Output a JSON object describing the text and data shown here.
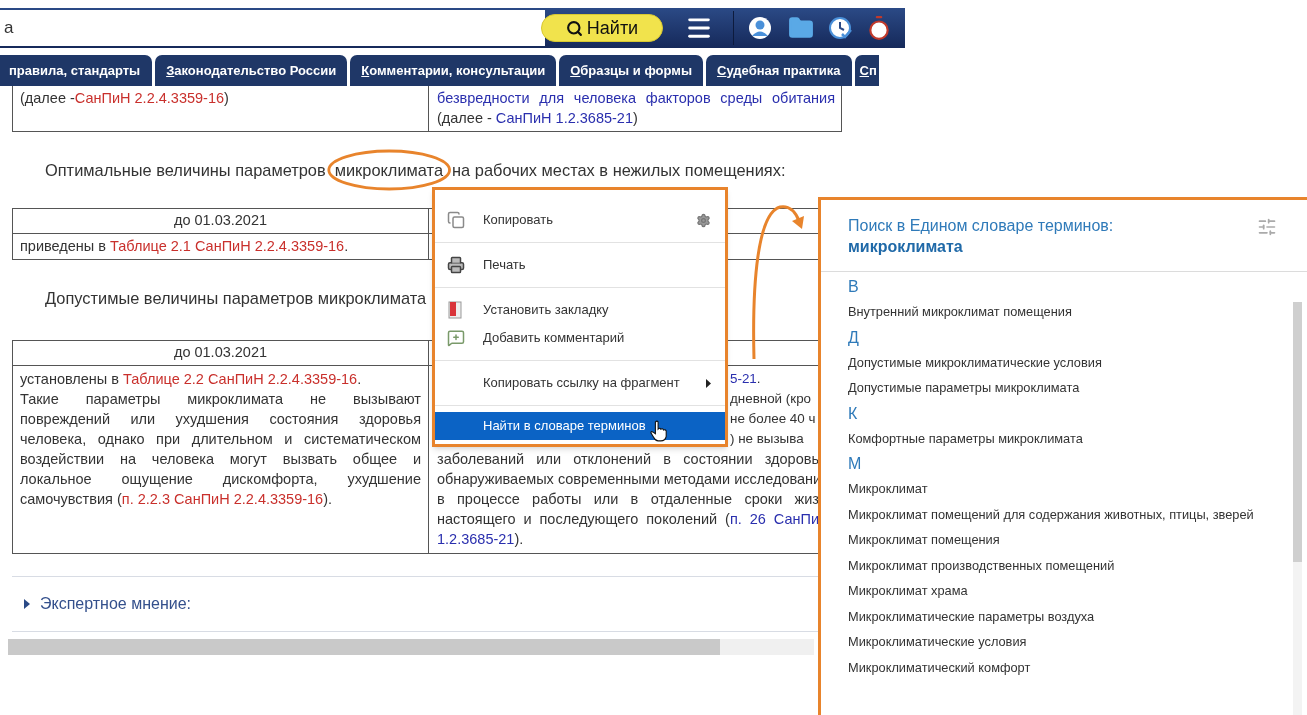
{
  "search": {
    "value": "а",
    "button": "Найти"
  },
  "tabs": [
    {
      "label": "правила, стандарты",
      "underline_first": false,
      "selected": false
    },
    {
      "label": "Законодательство России",
      "underline_first": true,
      "selected": false
    },
    {
      "label": "Комментарии, консультации",
      "underline_first": true,
      "selected": false
    },
    {
      "label": "Образцы и формы",
      "underline_first": true,
      "selected": false
    },
    {
      "label": "Судебная практика",
      "underline_first": true,
      "selected": false
    },
    {
      "label": "Сп",
      "underline_first": true,
      "selected": false
    }
  ],
  "document": {
    "top_table": {
      "left": [
        [
          {
            "text": "(далее -"
          },
          {
            "text": "СанПиН 2.2.4.3359-16",
            "link": true
          },
          {
            "text": ")"
          }
        ]
      ],
      "right": [
        {
          "kind": "full",
          "segments": [
            {
              "text": "безвредности для человека факторов среды обитания",
              "link": true
            }
          ]
        },
        {
          "kind": "last",
          "segments": [
            {
              "text": "(далее - "
            },
            {
              "text": "СанПиН 1.2.3685-21",
              "link": true
            },
            {
              "text": ")"
            }
          ]
        }
      ]
    },
    "paragraph_1": {
      "before": "Оптимальные величины параметров",
      "highlighted": "микроклимата",
      "after": "на рабочих местах в нежилых помещениях:"
    },
    "table_1": {
      "header": "до 01.03.2021",
      "cell": [
        {
          "text": "приведены в "
        },
        {
          "text": "Таблице 2.1 СанПиН 2.2.4.3359-16",
          "link": true
        },
        {
          "text": "."
        }
      ]
    },
    "paragraph_2": "Допустимые величины параметров микроклимата",
    "table_2": {
      "header": "до 01.03.2021",
      "left": [
        [
          {
            "text": "установлены в "
          },
          {
            "text": "Таблице 2.2 СанПиН 2.2.4.3359-16",
            "link": true
          },
          {
            "text": "."
          }
        ],
        [
          {
            "text": "Такие параметры микроклимата не вызывают повреждений или ухудшения состояния здоровья человека, однако при длительном и систематическом воздействии на человека могут вызвать общее и локальное ощущение дискомфорта, ухудшение самочувствия ("
          },
          {
            "text": "п. 2.2.3 СанПиН 2.2.4.3359-16",
            "link": true
          },
          {
            "text": ")."
          }
        ]
      ],
      "right": [
        {
          "kind": "partial",
          "segments": [
            {
              "text": "5-21",
              "link": true
            },
            {
              "text": "."
            }
          ]
        },
        {
          "kind": "partial",
          "segments": [
            {
              "text": "дневной (кро"
            }
          ]
        },
        {
          "kind": "partial",
          "segments": [
            {
              "text": "не более 40 ч"
            }
          ]
        },
        {
          "kind": "partial",
          "segments": [
            {
              "text": ") не вызыва"
            }
          ]
        },
        {
          "kind": "full",
          "segments": [
            {
              "text": "заболеваний или отклонений в состоянии здоровь"
            }
          ]
        },
        {
          "kind": "full",
          "segments": [
            {
              "text": "обнаруживаемых современными методами исследовани"
            }
          ]
        },
        {
          "kind": "full",
          "segments": [
            {
              "text": "в процессе работы или в отдаленные сроки жиз"
            }
          ]
        },
        {
          "kind": "full",
          "segments": [
            {
              "text": "настоящего и последующего поколений ("
            },
            {
              "text": "п. 26 СанПи",
              "link": true
            }
          ]
        },
        {
          "kind": "last",
          "segments": [
            {
              "text": "1.2.3685-21",
              "link": true
            },
            {
              "text": ")."
            }
          ]
        }
      ]
    },
    "expert": {
      "label": "Экспертное мнение:",
      "expanded": false
    }
  },
  "context_menu": {
    "groups": [
      [
        {
          "label": "Копировать",
          "selected": false,
          "submenu": false,
          "has_settings": true
        }
      ],
      [
        {
          "label": "Печать",
          "selected": false,
          "submenu": false,
          "has_settings": false
        }
      ],
      [
        {
          "label": "Установить закладку",
          "selected": false,
          "submenu": false,
          "has_settings": false
        },
        {
          "label": "Добавить комментарий",
          "selected": false,
          "submenu": false,
          "has_settings": false
        }
      ],
      [
        {
          "label": "Копировать ссылку на фрагмент",
          "selected": false,
          "submenu": true,
          "has_settings": false
        }
      ],
      [
        {
          "label": "Найти в словаре терминов",
          "selected": true,
          "submenu": false,
          "has_settings": false
        }
      ]
    ]
  },
  "dictionary": {
    "title": "Поиск в Едином словаре терминов:",
    "query": "микроклимата",
    "groups": [
      {
        "letter": "В",
        "terms": [
          "Внутренний микроклимат помещения"
        ]
      },
      {
        "letter": "Д",
        "terms": [
          "Допустимые микроклиматические условия",
          "Допустимые параметры микроклимата"
        ]
      },
      {
        "letter": "К",
        "terms": [
          "Комфортные параметры микроклимата"
        ]
      },
      {
        "letter": "М",
        "terms": [
          "Микроклимат",
          "Микроклимат помещений для содержания животных, птицы, зверей",
          "Микроклимат помещения",
          "Микроклимат производственных помещений",
          "Микроклимат храма",
          "Микроклиматические параметры воздуха",
          "Микроклиматические условия",
          "Микроклиматический комфорт"
        ]
      }
    ]
  }
}
